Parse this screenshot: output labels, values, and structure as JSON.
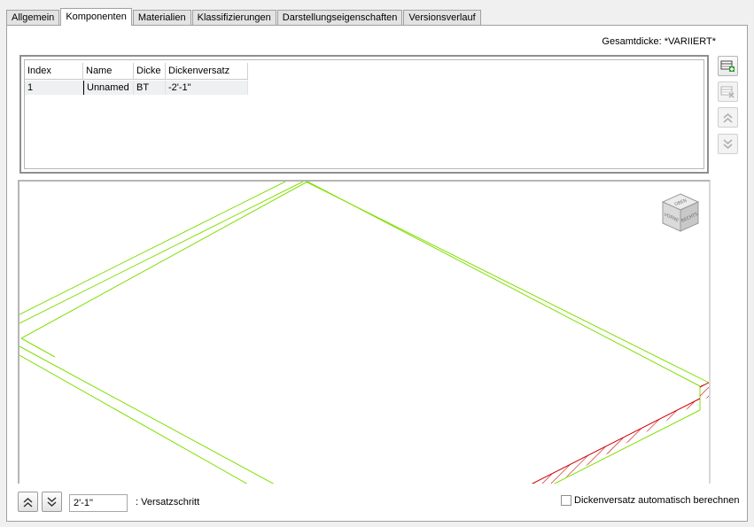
{
  "tabs": [
    {
      "label": "Allgemein",
      "active": false
    },
    {
      "label": "Komponenten",
      "active": true
    },
    {
      "label": "Materialien",
      "active": false
    },
    {
      "label": "Klassifizierungen",
      "active": false
    },
    {
      "label": "Darstellungseigenschaften",
      "active": false
    },
    {
      "label": "Versionsverlauf",
      "active": false
    }
  ],
  "total_thickness": "Gesamtdicke: *VARIIERT*",
  "grid": {
    "columns": [
      "Index",
      "Name",
      "Dicke",
      "Dickenversatz"
    ],
    "rows": [
      {
        "index": "1",
        "name": "Unnamed",
        "dicke": "BT",
        "versatz": "-2'-1\""
      }
    ]
  },
  "side_buttons": [
    "add-component-icon",
    "remove-component-icon",
    "move-up-icon",
    "move-down-icon"
  ],
  "view_cube": {
    "top": "OBEN",
    "left": "VORNE",
    "right": "RECHTS"
  },
  "preview_colors": {
    "edges": "#7fe000",
    "hatch": "#cc0000"
  },
  "offset_step": {
    "value": "2'-1\"",
    "label": ": Versatzschritt"
  },
  "auto_offset": {
    "label": "Dickenversatz automatisch berechnen",
    "checked": false
  }
}
